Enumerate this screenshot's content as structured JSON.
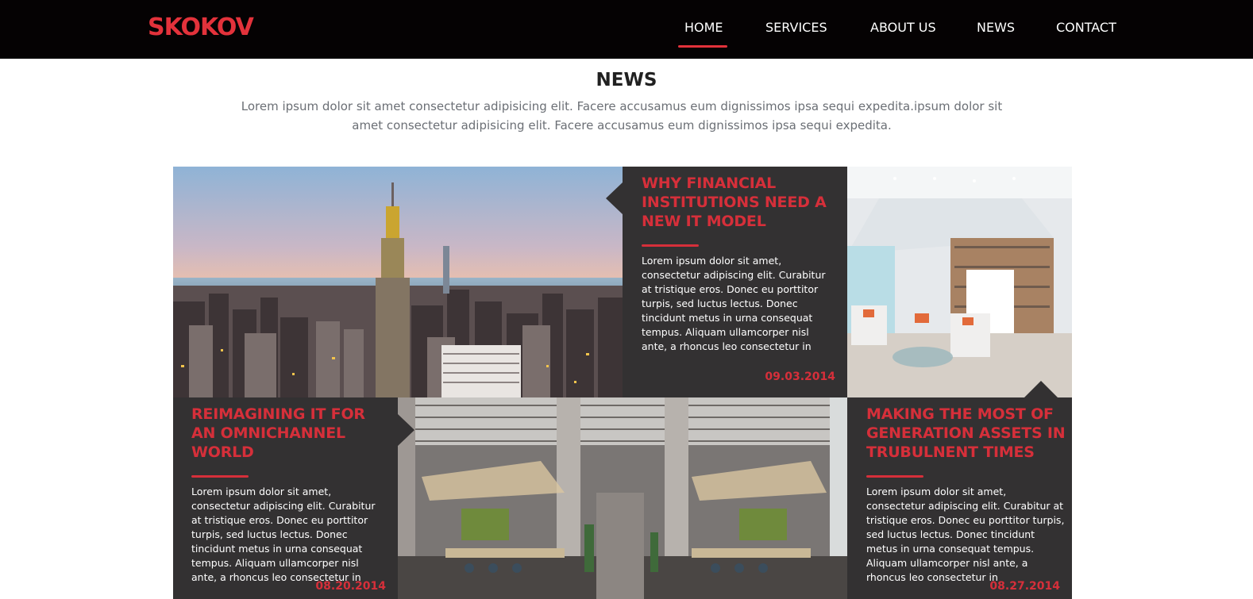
{
  "header": {
    "logo": "SKOKOV",
    "nav": [
      {
        "label": "HOME",
        "active": true
      },
      {
        "label": "SERVICES",
        "active": false
      },
      {
        "label": "ABOUT US",
        "active": false
      },
      {
        "label": "NEWS",
        "active": false
      },
      {
        "label": "CONTACT",
        "active": false
      }
    ]
  },
  "section": {
    "title": "NEWS",
    "description": "Lorem ipsum dolor sit amet consectetur adipisicing elit. Facere accusamus eum dignissimos ipsa sequi expedita.ipsum dolor sit amet consectetur adipisicing elit. Facere accusamus eum dignissimos ipsa sequi expedita."
  },
  "articles": [
    {
      "title": "WHY FINANCIAL INSTITUTIONS NEED A NEW IT MODEL",
      "text": "Lorem ipsum dolor sit amet, consectetur adipiscing elit. Curabitur at tristique eros. Donec eu porttitor turpis, sed luctus lectus. Donec tincidunt metus in urna consequat tempus. Aliquam ullamcorper nisl ante, a rhoncus leo consectetur in",
      "date": "09.03.2014"
    },
    {
      "title": "REIMAGINING IT FOR AN OMNICHANNEL WORLD",
      "text": "Lorem ipsum dolor sit amet, consectetur adipiscing elit. Curabitur at tristique eros. Donec eu porttitor turpis, sed luctus lectus. Donec tincidunt metus in urna consequat tempus. Aliquam ullamcorper nisl ante, a rhoncus leo consectetur in",
      "date": "08.20.2014"
    },
    {
      "title": "MAKING THE MOST OF GENERATION ASSETS IN TRUBULNENT TIMES",
      "text": "Lorem ipsum dolor sit amet, consectetur adipiscing elit. Curabitur at tristique eros. Donec eu porttitor turpis, sed luctus lectus. Donec tincidunt metus in urna consequat tempus. Aliquam ullamcorper nisl ante, a rhoncus leo consectetur in",
      "date": "08.27.2014"
    }
  ],
  "images": {
    "city": "city-skyline-photo",
    "lobby": "office-lobby-photo",
    "workspace": "industrial-office-photo"
  },
  "colors": {
    "accent": "#d62f3a",
    "header_bg": "#050203",
    "card_bg": "#333132"
  }
}
